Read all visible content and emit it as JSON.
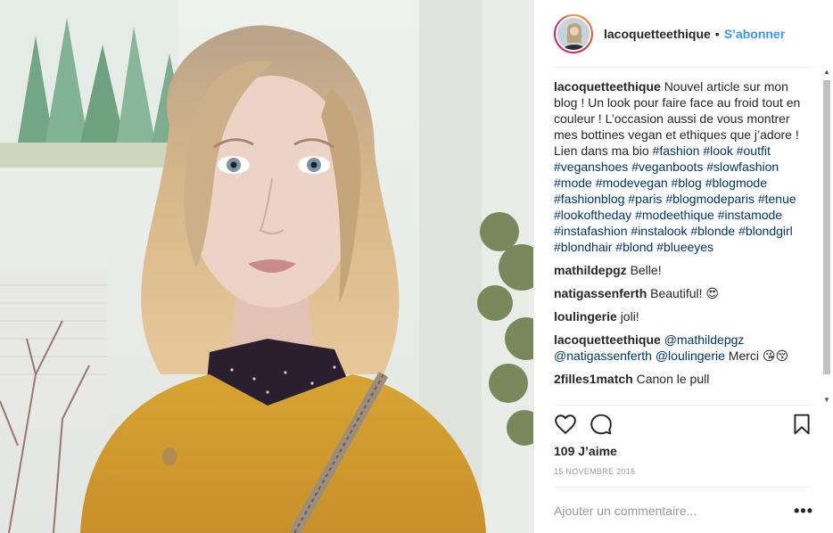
{
  "header": {
    "username": "lacoquetteethique",
    "separator": "•",
    "follow_label": "S’abonner"
  },
  "caption": {
    "username": "lacoquetteethique",
    "text": "Nouvel article sur mon blog ! Un look pour faire face au froid tout en couleur ! L’occasion aussi de vous montrer mes bottines vegan et ethiques que j’adore ! Lien dans ma bio",
    "hashtags": [
      "#fashion",
      "#look",
      "#outfit",
      "#veganshoes",
      "#veganboots",
      "#slowfashion",
      "#mode",
      "#modevegan",
      "#blog",
      "#blogmode",
      "#fashionblog",
      "#paris",
      "#blogmodeparis",
      "#tenue",
      "#lookoftheday",
      "#modeethique",
      "#instamode",
      "#instafashion",
      "#instalook",
      "#blonde",
      "#blondgirl",
      "#blondhair",
      "#blond",
      "#blueeyes"
    ]
  },
  "comments": [
    {
      "user": "mathildepgz",
      "text": "Belle!"
    },
    {
      "user": "natigassenferth",
      "text": "Beautiful! 😍"
    },
    {
      "user": "loulingerie",
      "text": "joli!"
    },
    {
      "user": "lacoquetteethique",
      "mentions": [
        "@mathildepgz",
        "@natigassenferth",
        "@loulingerie"
      ],
      "text": "Merci 😘😚"
    },
    {
      "user": "2filles1match",
      "text": "Canon le pull"
    }
  ],
  "likes": "109 J’aime",
  "date": "15 NOVEMBRE 2016",
  "add_comment": {
    "placeholder": "Ajouter un commentaire..."
  },
  "more_label": "•••",
  "icons": {
    "like": "heart-outline-icon",
    "comment": "speech-bubble-icon",
    "save": "bookmark-icon"
  },
  "colors": {
    "link": "#3897f0",
    "hashtag": "#003569",
    "muted": "#999999"
  }
}
